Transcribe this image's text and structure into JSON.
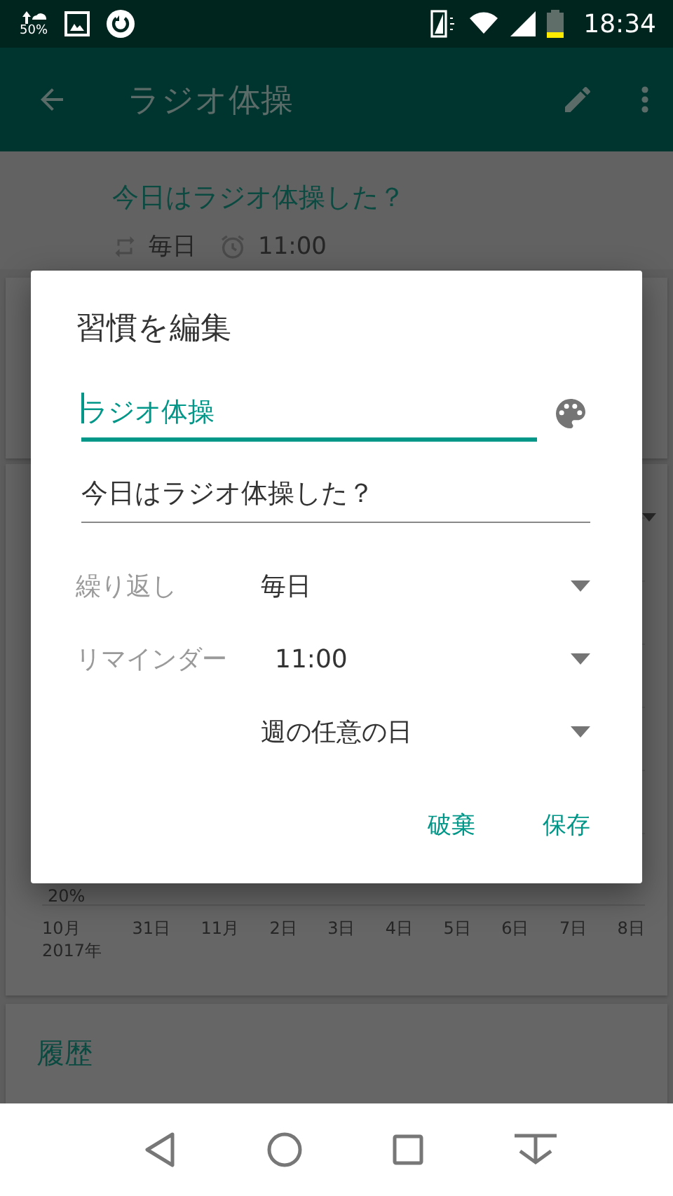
{
  "status_bar": {
    "data_saver": "50%",
    "time": "18:34"
  },
  "app_bar": {
    "title": "ラジオ体操"
  },
  "habit_header": {
    "question": "今日はラジオ体操した？",
    "repeat": "毎日",
    "reminder": "11:00"
  },
  "chart": {
    "y_label": "20%",
    "x_labels": [
      {
        "label": "10月",
        "sub": "2017年"
      },
      {
        "label": "31日"
      },
      {
        "label": "11月"
      },
      {
        "label": "2日"
      },
      {
        "label": "3日"
      },
      {
        "label": "4日"
      },
      {
        "label": "5日"
      },
      {
        "label": "6日"
      },
      {
        "label": "7日"
      },
      {
        "label": "8日"
      }
    ]
  },
  "history": {
    "title": "履歴"
  },
  "dialog": {
    "title": "習慣を編集",
    "fields": [
      {
        "value": "ラジオ体操",
        "focused": true,
        "palette": true
      },
      {
        "value": "今日はラジオ体操した？",
        "focused": false,
        "palette": false
      }
    ],
    "settings": [
      {
        "label": "繰り返し",
        "value": "毎日"
      },
      {
        "label": "リマインダー",
        "value": "11:00"
      },
      {
        "value": "週の任意の日"
      }
    ],
    "buttons": [
      "破棄",
      "保存"
    ]
  }
}
